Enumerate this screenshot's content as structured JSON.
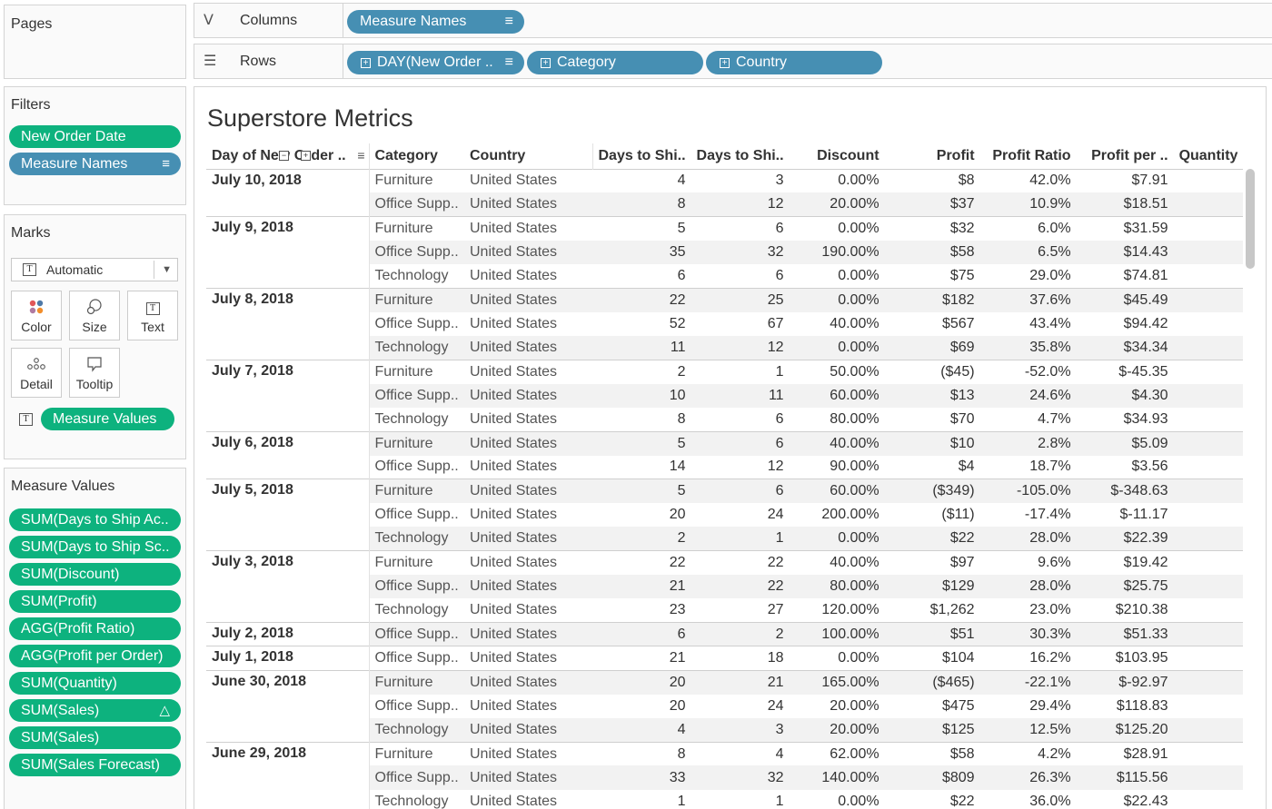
{
  "sidebar": {
    "pages": {
      "title": "Pages"
    },
    "filters": {
      "title": "Filters",
      "pills": [
        "New Order Date",
        "Measure Names"
      ]
    },
    "marks": {
      "title": "Marks",
      "mark_type": "Automatic",
      "buttons": {
        "color": "Color",
        "size": "Size",
        "text": "Text",
        "detail": "Detail",
        "tooltip": "Tooltip"
      },
      "text_pill": "Measure Values"
    },
    "measure_values": {
      "title": "Measure Values",
      "pills": [
        "SUM(Days to Ship Ac..",
        "SUM(Days to Ship Sc..",
        "SUM(Discount)",
        "SUM(Profit)",
        "AGG(Profit Ratio)",
        "AGG(Profit per Order)",
        "SUM(Quantity)",
        "SUM(Sales)",
        "SUM(Sales)",
        "SUM(Sales Forecast)"
      ]
    }
  },
  "shelves": {
    "columns": {
      "label": "Columns",
      "pills": [
        "Measure Names"
      ]
    },
    "rows": {
      "label": "Rows",
      "pills": [
        "DAY(New Order ..",
        "Category",
        "Country"
      ]
    }
  },
  "view": {
    "title": "Superstore Metrics",
    "headers": {
      "date": "Day of New Order ..",
      "category": "Category",
      "country": "Country",
      "measures": [
        "Days to Shi..",
        "Days to Shi..",
        "Discount",
        "Profit",
        "Profit Ratio",
        "Profit per ..",
        "Quantity"
      ]
    },
    "groups": [
      {
        "date": "July 10, 2018",
        "rows": [
          [
            "Furniture",
            "United States",
            "4",
            "3",
            "0.00%",
            "$8",
            "42.0%",
            "$7.91"
          ],
          [
            "Office Supp..",
            "United States",
            "8",
            "12",
            "20.00%",
            "$37",
            "10.9%",
            "$18.51"
          ]
        ]
      },
      {
        "date": "July 9, 2018",
        "rows": [
          [
            "Furniture",
            "United States",
            "5",
            "6",
            "0.00%",
            "$32",
            "6.0%",
            "$31.59"
          ],
          [
            "Office Supp..",
            "United States",
            "35",
            "32",
            "190.00%",
            "$58",
            "6.5%",
            "$14.43"
          ],
          [
            "Technology",
            "United States",
            "6",
            "6",
            "0.00%",
            "$75",
            "29.0%",
            "$74.81"
          ]
        ]
      },
      {
        "date": "July 8, 2018",
        "rows": [
          [
            "Furniture",
            "United States",
            "22",
            "25",
            "0.00%",
            "$182",
            "37.6%",
            "$45.49"
          ],
          [
            "Office Supp..",
            "United States",
            "52",
            "67",
            "40.00%",
            "$567",
            "43.4%",
            "$94.42"
          ],
          [
            "Technology",
            "United States",
            "11",
            "12",
            "0.00%",
            "$69",
            "35.8%",
            "$34.34"
          ]
        ]
      },
      {
        "date": "July 7, 2018",
        "rows": [
          [
            "Furniture",
            "United States",
            "2",
            "1",
            "50.00%",
            "($45)",
            "-52.0%",
            "$-45.35"
          ],
          [
            "Office Supp..",
            "United States",
            "10",
            "11",
            "60.00%",
            "$13",
            "24.6%",
            "$4.30"
          ],
          [
            "Technology",
            "United States",
            "8",
            "6",
            "80.00%",
            "$70",
            "4.7%",
            "$34.93"
          ]
        ]
      },
      {
        "date": "July 6, 2018",
        "rows": [
          [
            "Furniture",
            "United States",
            "5",
            "6",
            "40.00%",
            "$10",
            "2.8%",
            "$5.09"
          ],
          [
            "Office Supp..",
            "United States",
            "14",
            "12",
            "90.00%",
            "$4",
            "18.7%",
            "$3.56"
          ]
        ]
      },
      {
        "date": "July 5, 2018",
        "rows": [
          [
            "Furniture",
            "United States",
            "5",
            "6",
            "60.00%",
            "($349)",
            "-105.0%",
            "$-348.63"
          ],
          [
            "Office Supp..",
            "United States",
            "20",
            "24",
            "200.00%",
            "($11)",
            "-17.4%",
            "$-11.17"
          ],
          [
            "Technology",
            "United States",
            "2",
            "1",
            "0.00%",
            "$22",
            "28.0%",
            "$22.39"
          ]
        ]
      },
      {
        "date": "July 3, 2018",
        "rows": [
          [
            "Furniture",
            "United States",
            "22",
            "22",
            "40.00%",
            "$97",
            "9.6%",
            "$19.42"
          ],
          [
            "Office Supp..",
            "United States",
            "21",
            "22",
            "80.00%",
            "$129",
            "28.0%",
            "$25.75"
          ],
          [
            "Technology",
            "United States",
            "23",
            "27",
            "120.00%",
            "$1,262",
            "23.0%",
            "$210.38"
          ]
        ]
      },
      {
        "date": "July 2, 2018",
        "rows": [
          [
            "Office Supp..",
            "United States",
            "6",
            "2",
            "100.00%",
            "$51",
            "30.3%",
            "$51.33"
          ]
        ]
      },
      {
        "date": "July 1, 2018",
        "rows": [
          [
            "Office Supp..",
            "United States",
            "21",
            "18",
            "0.00%",
            "$104",
            "16.2%",
            "$103.95"
          ]
        ]
      },
      {
        "date": "June 30, 2018",
        "rows": [
          [
            "Furniture",
            "United States",
            "20",
            "21",
            "165.00%",
            "($465)",
            "-22.1%",
            "$-92.97"
          ],
          [
            "Office Supp..",
            "United States",
            "20",
            "24",
            "20.00%",
            "$475",
            "29.4%",
            "$118.83"
          ],
          [
            "Technology",
            "United States",
            "4",
            "3",
            "20.00%",
            "$125",
            "12.5%",
            "$125.20"
          ]
        ]
      },
      {
        "date": "June 29, 2018",
        "rows": [
          [
            "Furniture",
            "United States",
            "8",
            "4",
            "62.00%",
            "$58",
            "4.2%",
            "$28.91"
          ],
          [
            "Office Supp..",
            "United States",
            "33",
            "32",
            "140.00%",
            "$809",
            "26.3%",
            "$115.56"
          ],
          [
            "Technology",
            "United States",
            "1",
            "1",
            "0.00%",
            "$22",
            "36.0%",
            "$22.43"
          ]
        ]
      }
    ]
  },
  "colors": {
    "pill_green": "#0db27e",
    "pill_blue": "#468fb3",
    "stripe": "#f2f2f2"
  }
}
